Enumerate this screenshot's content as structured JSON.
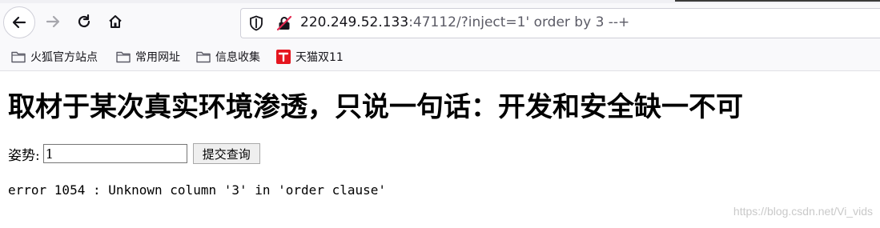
{
  "browser": {
    "url_host": "220.249.52.133",
    "url_rest": ":47112/?inject=1' order by 3 --+"
  },
  "bookmarks": [
    {
      "label": "火狐官方站点",
      "icon": "folder-icon"
    },
    {
      "label": "常用网址",
      "icon": "folder-icon"
    },
    {
      "label": "信息收集",
      "icon": "folder-icon"
    },
    {
      "label": "天猫双11",
      "icon": "tmall-icon"
    }
  ],
  "page": {
    "heading": "取材于某次真实环境渗透，只说一句话：开发和安全缺一不可",
    "form_label": "姿势:",
    "input_value": "1",
    "submit_label": "提交查询",
    "error_text": "error 1054 : Unknown column '3' in 'order clause'"
  },
  "watermark": "https://blog.csdn.net/Vi_vids",
  "colors": {
    "toolbar_bg": "#f9f9fb",
    "urlbar_border": "#cfcfd8",
    "tmall_red": "#e5151f"
  }
}
